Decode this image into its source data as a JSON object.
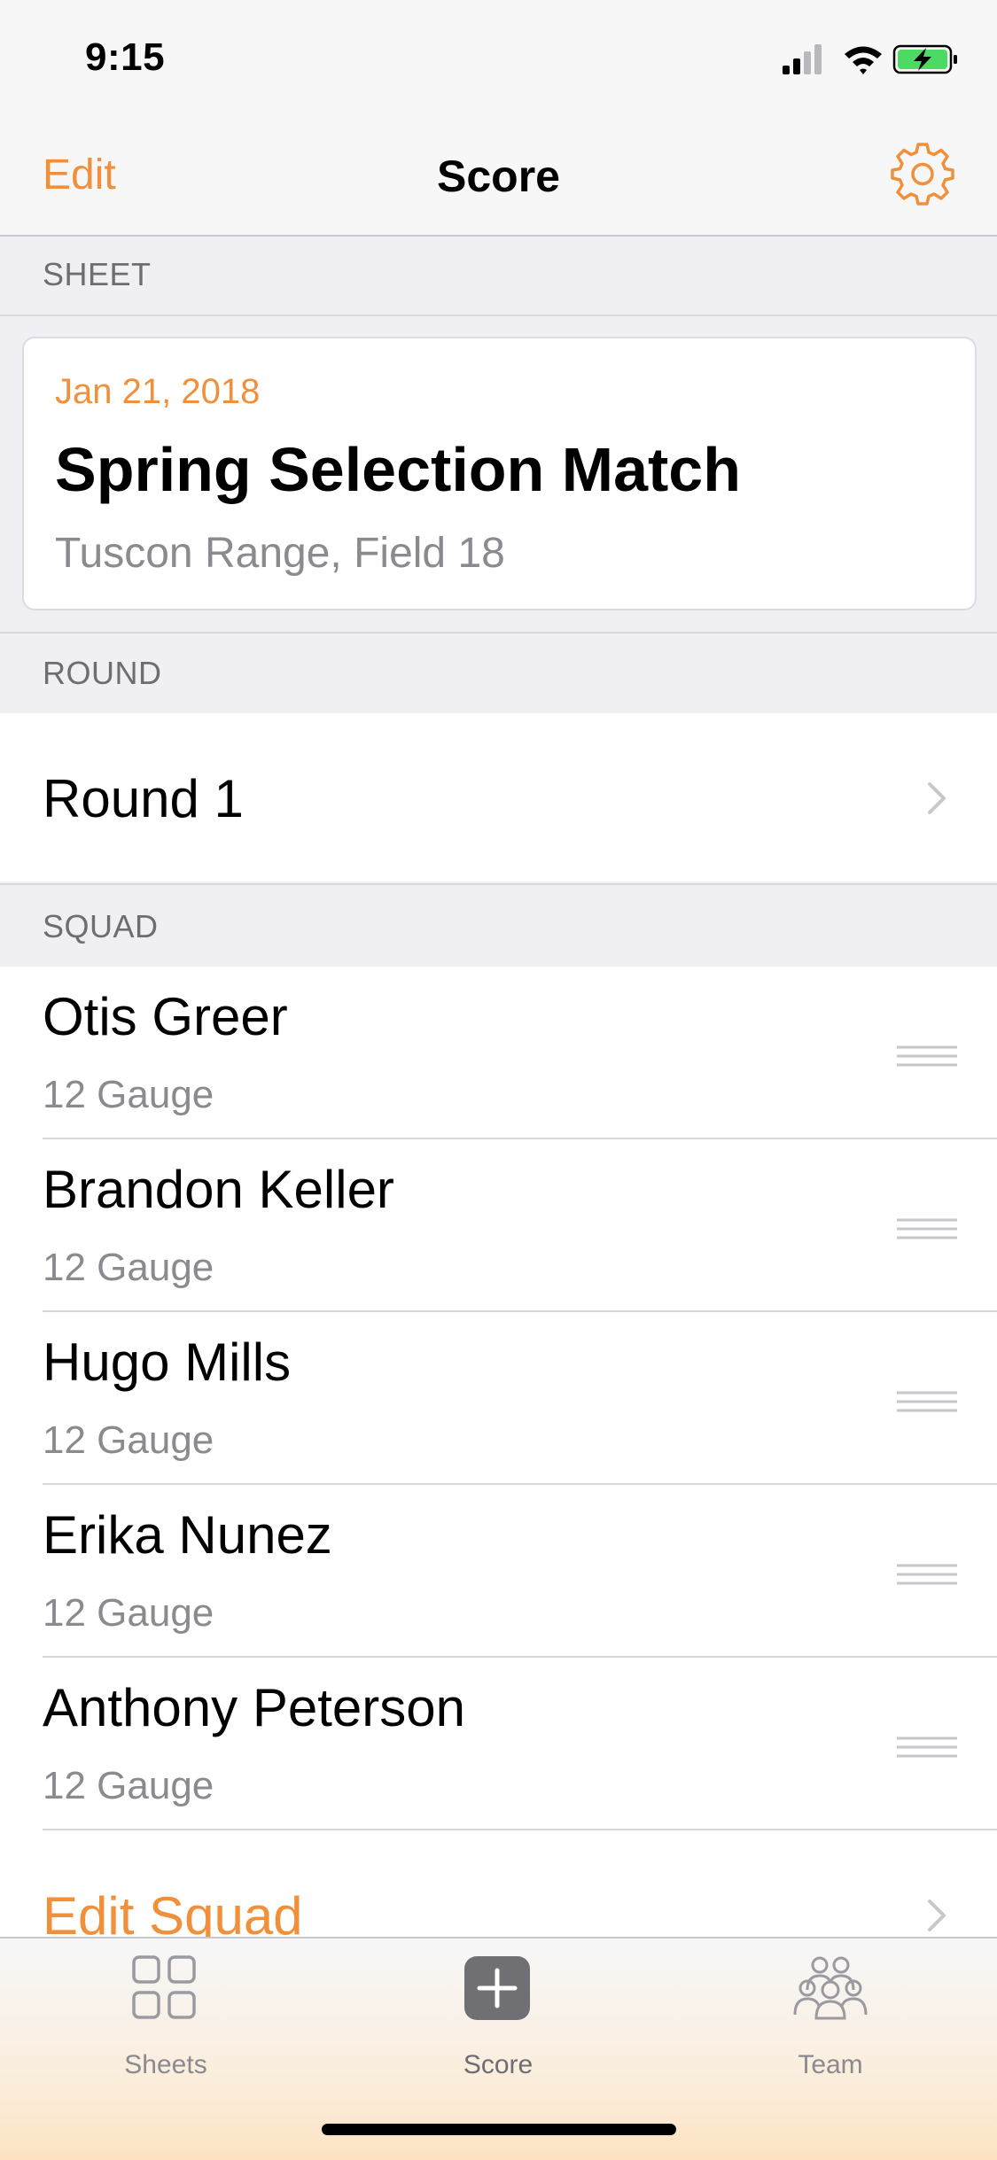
{
  "status_bar": {
    "time": "9:15",
    "icons": [
      "cellular-signal-icon",
      "wifi-icon",
      "battery-charging-icon"
    ]
  },
  "nav": {
    "edit_label": "Edit",
    "title": "Score",
    "settings_icon": "gear-icon"
  },
  "colors": {
    "accent": "#f0903a",
    "background": "#efeff4",
    "secondary_text": "#8a8a8f",
    "battery": "#4cd964"
  },
  "sections": {
    "sheet": "SHEET",
    "round": "ROUND",
    "squad": "SQUAD"
  },
  "sheet": {
    "date": "Jan 21, 2018",
    "title": "Spring Selection Match",
    "location": "Tuscon Range, Field 18"
  },
  "round": {
    "label": "Round 1"
  },
  "squad": {
    "players": [
      {
        "name": "Otis Greer",
        "gauge": "12 Gauge"
      },
      {
        "name": "Brandon Keller",
        "gauge": "12 Gauge"
      },
      {
        "name": "Hugo Mills",
        "gauge": "12 Gauge"
      },
      {
        "name": "Erika Nunez",
        "gauge": "12 Gauge"
      },
      {
        "name": "Anthony Peterson",
        "gauge": "12 Gauge"
      }
    ],
    "edit_label": "Edit Squad"
  },
  "tabbar": {
    "tabs": [
      {
        "label": "Sheets",
        "icon": "grid-icon",
        "active": false
      },
      {
        "label": "Score",
        "icon": "plus-icon",
        "active": true
      },
      {
        "label": "Team",
        "icon": "team-icon",
        "active": false
      }
    ]
  }
}
